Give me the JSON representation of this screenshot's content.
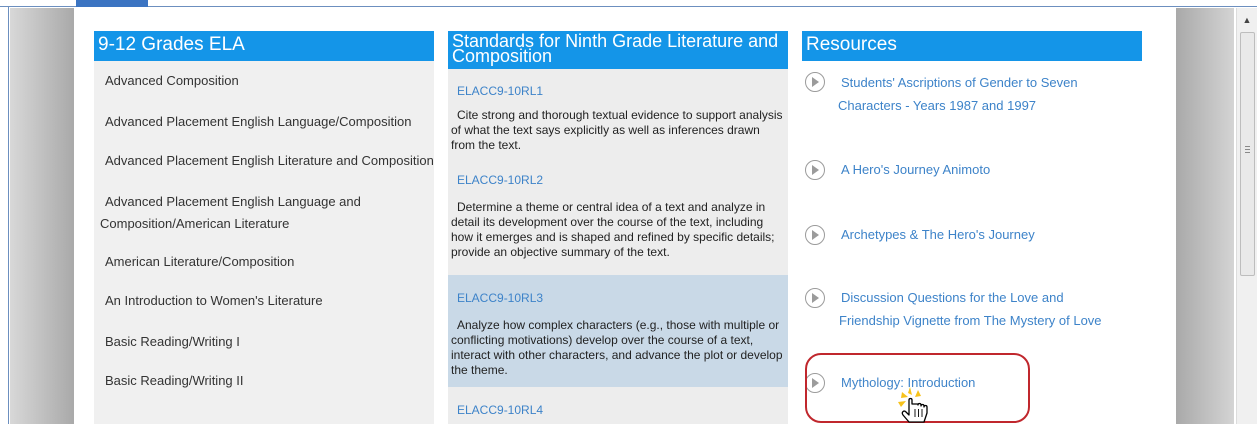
{
  "colors": {
    "header_blue": "#1495e8",
    "link_blue": "#3d83c9",
    "highlight_row": "#c9d9e7",
    "focus_ring": "#c0272d"
  },
  "grades": {
    "title": "9-12 Grades ELA",
    "courses": [
      "Advanced Composition",
      "Advanced Placement English Language/Composition",
      "Advanced Placement English Literature and Composition",
      "Advanced Placement English Language and Composition/American Literature",
      "American Literature/Composition",
      "An Introduction to Women's Literature",
      "Basic Reading/Writing I",
      "Basic Reading/Writing II"
    ]
  },
  "standards": {
    "title": "Standards for Ninth Grade Literature and Composition",
    "items": [
      {
        "code": "ELACC9-10RL1",
        "text": "Cite strong and thorough textual evidence to support analysis of what the text says explicitly as well as inferences drawn from the text."
      },
      {
        "code": "ELACC9-10RL2",
        "text": "Determine a theme or central idea of a text and analyze in detail its development over the course of the text, including how it emerges and is shaped and refined by specific details; provide an objective summary of the text."
      },
      {
        "code": "ELACC9-10RL3",
        "text": "Analyze how complex characters (e.g., those with multiple or conflicting motivations) develop over the course of a text, interact with other characters, and advance the plot or develop the theme."
      },
      {
        "code": "ELACC9-10RL4",
        "text": ""
      }
    ]
  },
  "resources": {
    "title": "Resources",
    "items": [
      {
        "label": "Students' Ascriptions of Gender to Seven Characters - Years 1987 and 1997",
        "icon": "play-circle-icon"
      },
      {
        "label": "A Hero's Journey Animoto",
        "icon": "play-circle-icon"
      },
      {
        "label": "Archetypes & The Hero's Journey",
        "icon": "play-circle-icon"
      },
      {
        "label": "Discussion Questions for the Love and Friendship Vignette from The Mystery of Love",
        "icon": "play-circle-icon"
      },
      {
        "label": "Mythology: Introduction",
        "icon": "play-circle-icon"
      }
    ]
  },
  "icons": {
    "scroll_up": "scroll-up-arrow-icon",
    "cursor": "hand-pointer-cursor-icon"
  }
}
